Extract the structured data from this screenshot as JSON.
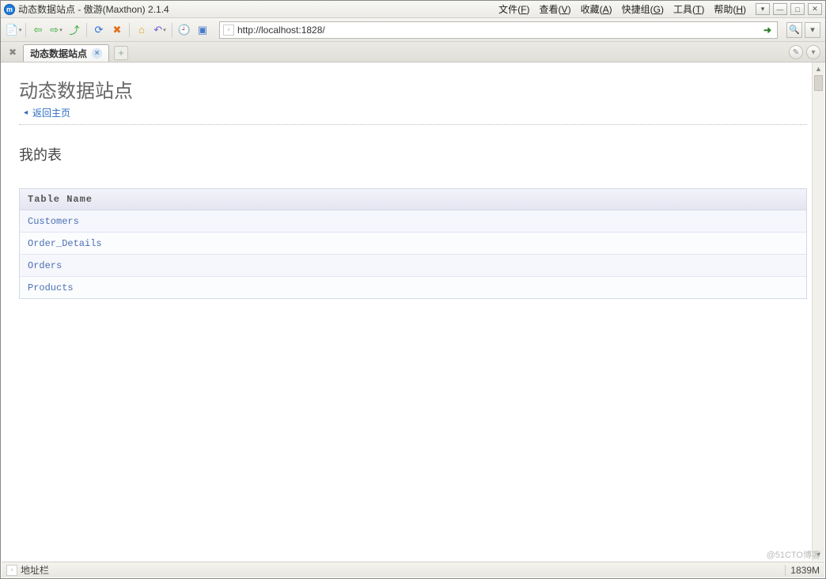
{
  "window": {
    "title": "动态数据站点 - 傲游(Maxthon) 2.1.4"
  },
  "menus": [
    {
      "label": "文件",
      "key": "F"
    },
    {
      "label": "查看",
      "key": "V"
    },
    {
      "label": "收藏",
      "key": "A"
    },
    {
      "label": "快捷组",
      "key": "G"
    },
    {
      "label": "工具",
      "key": "T"
    },
    {
      "label": "帮助",
      "key": "H"
    }
  ],
  "address": {
    "url": "http://localhost:1828/"
  },
  "tab": {
    "title": "动态数据站点"
  },
  "page": {
    "heading": "动态数据站点",
    "back_label": "返回主页",
    "subheading": "我的表",
    "table_header": "Table Name",
    "tables": [
      {
        "name": "Customers"
      },
      {
        "name": "Order_Details"
      },
      {
        "name": "Orders"
      },
      {
        "name": "Products"
      }
    ]
  },
  "status": {
    "label": "地址栏",
    "memory": "1839M"
  },
  "watermark": "@51CTO博客"
}
